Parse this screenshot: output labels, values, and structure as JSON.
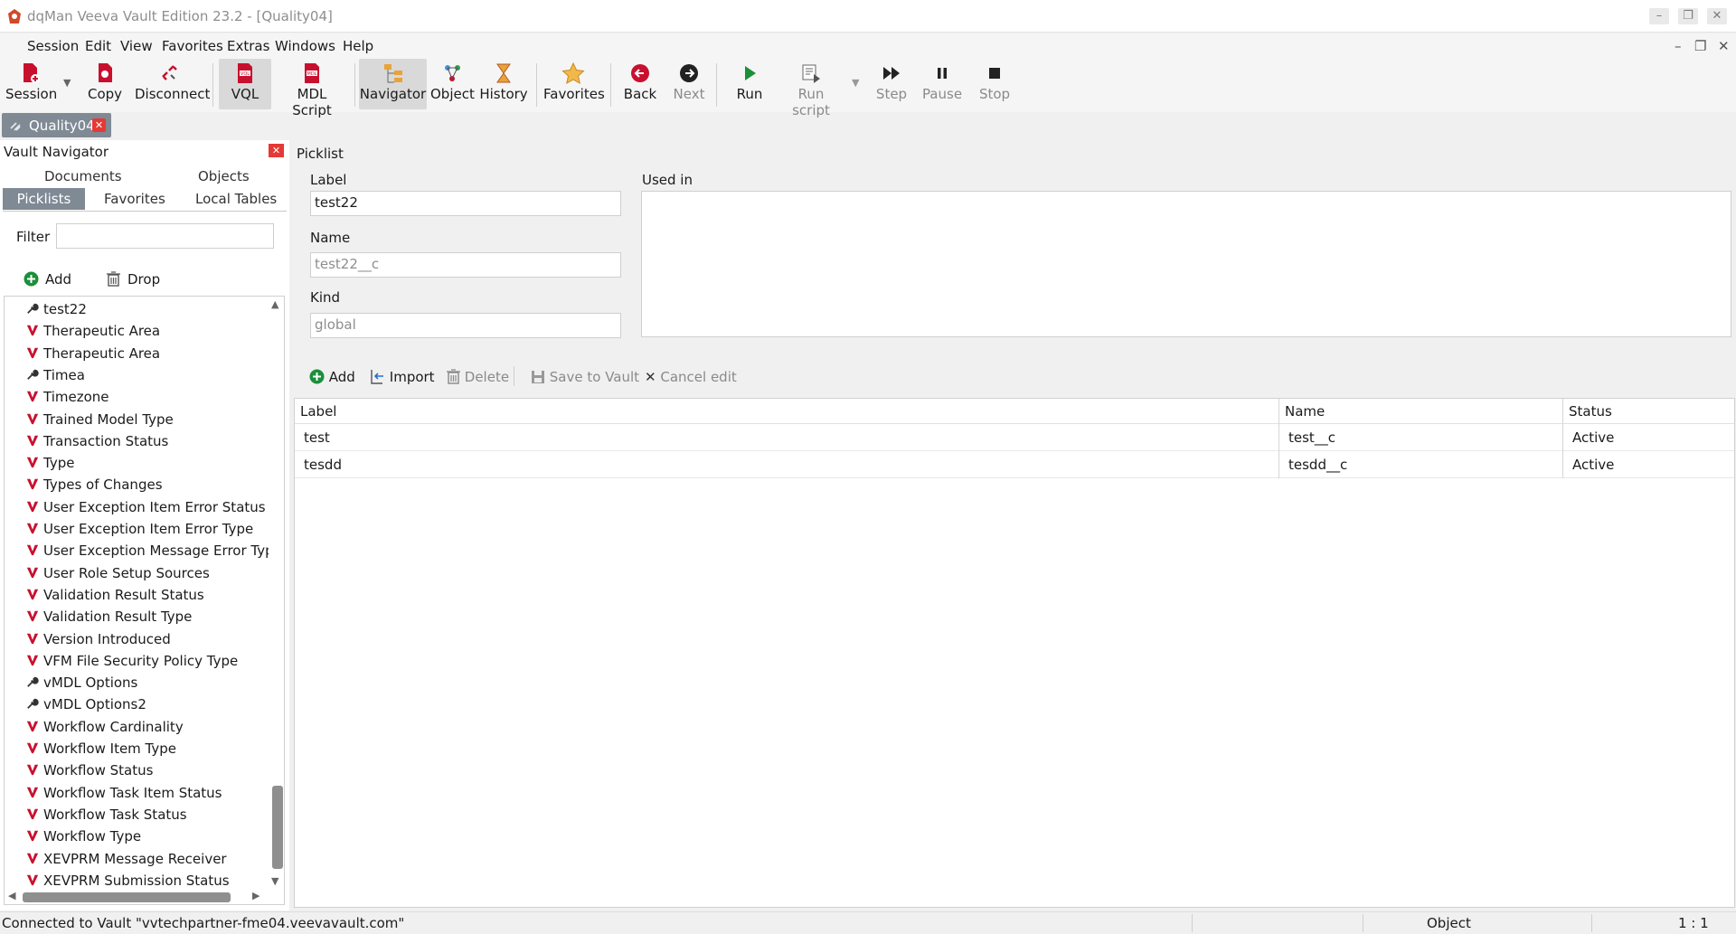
{
  "window": {
    "title": "dqMan Veeva Vault Edition 23.2 - [Quality04]"
  },
  "menu": [
    "Session",
    "Edit",
    "View",
    "Favorites",
    "Extras",
    "Windows",
    "Help"
  ],
  "toolbar": {
    "session": "Session",
    "copy": "Copy",
    "disconnect": "Disconnect",
    "vql": "VQL",
    "mdl_script": "MDL Script",
    "navigator": "Navigator",
    "object": "Object",
    "history": "History",
    "favorites": "Favorites",
    "back": "Back",
    "next": "Next",
    "run": "Run",
    "run_script": "Run script",
    "step": "Step",
    "pause": "Pause",
    "stop": "Stop"
  },
  "session_tab": "Quality04",
  "navigator": {
    "title": "Vault Navigator",
    "tabs_row1": [
      "Documents",
      "Objects"
    ],
    "tabs_row2": [
      "Picklists",
      "Favorites",
      "Local Tables"
    ],
    "filter_label": "Filter",
    "filter_value": "",
    "add": "Add",
    "drop": "Drop",
    "items": [
      {
        "label": "test22",
        "icon": "wrench-icon"
      },
      {
        "label": "Therapeutic Area",
        "icon": "veeva-v-icon"
      },
      {
        "label": "Therapeutic Area",
        "icon": "veeva-v-icon"
      },
      {
        "label": "Timea",
        "icon": "wrench-icon"
      },
      {
        "label": "Timezone",
        "icon": "veeva-v-icon"
      },
      {
        "label": "Trained Model Type",
        "icon": "veeva-v-icon"
      },
      {
        "label": "Transaction Status",
        "icon": "veeva-v-icon"
      },
      {
        "label": "Type",
        "icon": "veeva-v-icon"
      },
      {
        "label": "Types of Changes",
        "icon": "veeva-v-icon"
      },
      {
        "label": "User Exception Item Error Status",
        "icon": "veeva-v-icon"
      },
      {
        "label": "User Exception Item Error Type",
        "icon": "veeva-v-icon"
      },
      {
        "label": "User Exception Message Error Type",
        "icon": "veeva-v-icon"
      },
      {
        "label": "User Role Setup Sources",
        "icon": "veeva-v-icon"
      },
      {
        "label": "Validation Result Status",
        "icon": "veeva-v-icon"
      },
      {
        "label": "Validation Result Type",
        "icon": "veeva-v-icon"
      },
      {
        "label": "Version Introduced",
        "icon": "veeva-v-icon"
      },
      {
        "label": "VFM File Security Policy Type",
        "icon": "veeva-v-icon"
      },
      {
        "label": "vMDL Options",
        "icon": "wrench-icon"
      },
      {
        "label": "vMDL Options2",
        "icon": "wrench-icon"
      },
      {
        "label": "Workflow Cardinality",
        "icon": "veeva-v-icon"
      },
      {
        "label": "Workflow Item Type",
        "icon": "veeva-v-icon"
      },
      {
        "label": "Workflow Status",
        "icon": "veeva-v-icon"
      },
      {
        "label": "Workflow Task Item Status",
        "icon": "veeva-v-icon"
      },
      {
        "label": "Workflow Task Status",
        "icon": "veeva-v-icon"
      },
      {
        "label": "Workflow Type",
        "icon": "veeva-v-icon"
      },
      {
        "label": "XEVPRM Message Receiver",
        "icon": "veeva-v-icon"
      },
      {
        "label": "XEVPRM Submission Status",
        "icon": "veeva-v-icon"
      }
    ]
  },
  "picklist": {
    "title": "Picklist",
    "label_caption": "Label",
    "label_value": "test22",
    "name_caption": "Name",
    "name_value": "test22__c",
    "kind_caption": "Kind",
    "kind_value": "global",
    "used_in_caption": "Used in"
  },
  "grid_toolbar": {
    "add": "Add",
    "import": "Import",
    "delete": "Delete",
    "save": "Save to Vault",
    "cancel": "Cancel edit"
  },
  "grid": {
    "columns": [
      "Label",
      "Name",
      "Status"
    ],
    "rows": [
      [
        "test",
        "test__c",
        "Active"
      ],
      [
        "tesdd",
        "tesdd__c",
        "Active"
      ]
    ]
  },
  "statusbar": {
    "message": "Connected to Vault \"vvtechpartner-fme04.veevavault.com\"",
    "mode": "Object",
    "position": "1 : 1"
  },
  "colors": {
    "accent_red": "#c8102e",
    "tab_gray": "#7f8a95",
    "run_green": "#1b8f3a"
  }
}
